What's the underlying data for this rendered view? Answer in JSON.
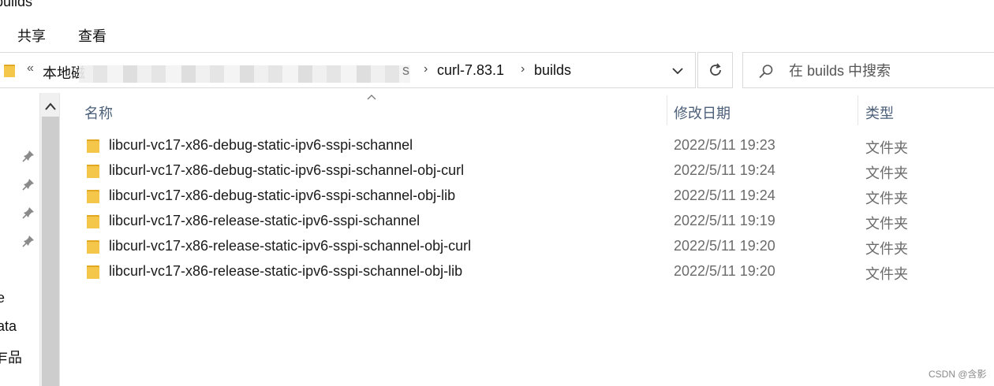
{
  "window": {
    "title_fragment": "builds"
  },
  "ribbon": {
    "tabs": [
      {
        "label": "共享"
      },
      {
        "label": "查看"
      }
    ]
  },
  "address_bar": {
    "overflow_glyph": "«",
    "first_crumb": "本地磁",
    "partial_fragment": "s",
    "crumbs": [
      {
        "label": "curl-7.83.1"
      },
      {
        "label": "builds"
      }
    ],
    "separator": "›"
  },
  "search": {
    "placeholder": "在 builds 中搜索"
  },
  "nav_pane": {
    "pinned_count": 4,
    "fragments": [
      {
        "text": "e"
      },
      {
        "text": "ata"
      },
      {
        "text": "乍品"
      }
    ]
  },
  "columns": {
    "name": "名称",
    "date": "修改日期",
    "type": "类型"
  },
  "files": [
    {
      "name": "libcurl-vc17-x86-debug-static-ipv6-sspi-schannel",
      "date": "2022/5/11 19:23",
      "type": "文件夹"
    },
    {
      "name": "libcurl-vc17-x86-debug-static-ipv6-sspi-schannel-obj-curl",
      "date": "2022/5/11 19:24",
      "type": "文件夹"
    },
    {
      "name": "libcurl-vc17-x86-debug-static-ipv6-sspi-schannel-obj-lib",
      "date": "2022/5/11 19:24",
      "type": "文件夹"
    },
    {
      "name": "libcurl-vc17-x86-release-static-ipv6-sspi-schannel",
      "date": "2022/5/11 19:19",
      "type": "文件夹"
    },
    {
      "name": "libcurl-vc17-x86-release-static-ipv6-sspi-schannel-obj-curl",
      "date": "2022/5/11 19:20",
      "type": "文件夹"
    },
    {
      "name": "libcurl-vc17-x86-release-static-ipv6-sspi-schannel-obj-lib",
      "date": "2022/5/11 19:20",
      "type": "文件夹"
    }
  ],
  "watermark": "CSDN @含影",
  "colors": {
    "folder": "#f4c64a",
    "folder_dark": "#e0a823",
    "header_text": "#4c607a",
    "meta_text": "#6b6b6b"
  }
}
